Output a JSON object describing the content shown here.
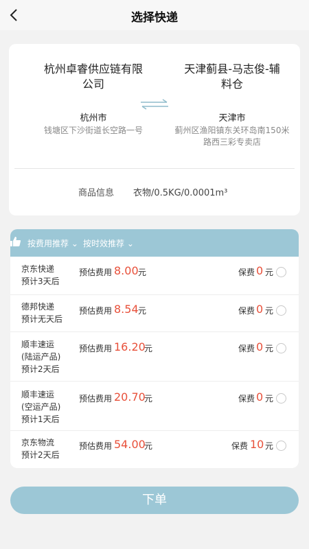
{
  "header": {
    "title": "选择快递"
  },
  "route": {
    "from": {
      "name": "杭州卓睿供应链有限公司",
      "city": "杭州市",
      "address": "钱塘区下沙街道长空路一号"
    },
    "to": {
      "name": "天津蓟县-马志俊-辅料仓",
      "city": "天津市",
      "address": "蓟州区渔阳镇东关环岛南150米路西三彩专卖店"
    }
  },
  "goods": {
    "label": "商品信息",
    "value": "衣物/0.5KG/0.0001m³"
  },
  "sort": {
    "by_fee": "按费用推荐",
    "by_time": "按时效推荐"
  },
  "est_label": "预估费用",
  "ins_label": "保费",
  "unit": "元",
  "options": [
    {
      "carrier": "京东快递",
      "detail": "",
      "eta": "预计3天后",
      "fee": "8.00",
      "insurance": "0"
    },
    {
      "carrier": "德邦快递",
      "detail": "",
      "eta": "预计无天后",
      "fee": "8.54",
      "insurance": "0"
    },
    {
      "carrier": "顺丰速运",
      "detail": "(陆运产品)",
      "eta": "预计2天后",
      "fee": "16.20",
      "insurance": "0"
    },
    {
      "carrier": "顺丰速运",
      "detail": "(空运产品)",
      "eta": "预计1天后",
      "fee": "20.70",
      "insurance": "0"
    },
    {
      "carrier": "京东物流",
      "detail": "",
      "eta": "预计2天后",
      "fee": "54.00",
      "insurance": "10"
    }
  ],
  "submit_label": "下单",
  "colors": {
    "accent": "#9cc7d6",
    "price": "#e8503a"
  }
}
